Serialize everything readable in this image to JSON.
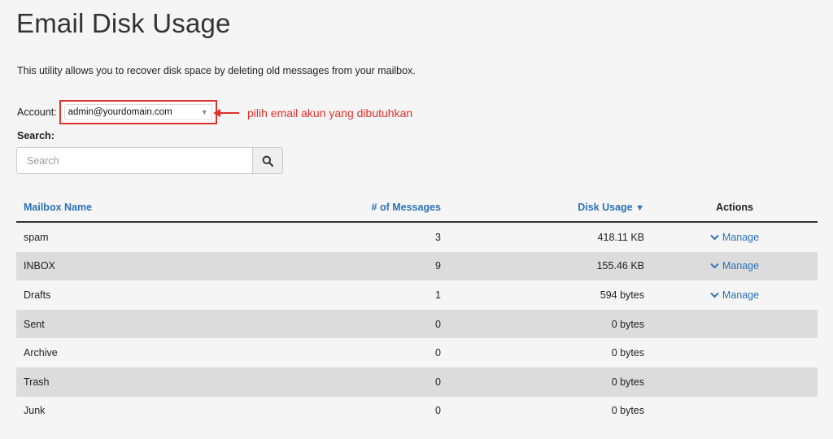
{
  "page": {
    "title": "Email Disk Usage",
    "intro": "This utility allows you to recover disk space by deleting old messages from your mailbox."
  },
  "account": {
    "label": "Account:",
    "selected": "admin@yourdomain.com"
  },
  "annotation": {
    "text": "pilih email akun yang dibutuhkan",
    "color": "#e0302a"
  },
  "search": {
    "label": "Search:",
    "placeholder": "Search",
    "button_icon": "search-icon"
  },
  "table": {
    "headers": {
      "name": "Mailbox Name",
      "messages": "# of Messages",
      "usage": "Disk Usage",
      "usage_sort": "▼",
      "actions": "Actions"
    },
    "rows": [
      {
        "name": "spam",
        "messages": "3",
        "usage": "418.11 KB",
        "action": "Manage"
      },
      {
        "name": "INBOX",
        "messages": "9",
        "usage": "155.46 KB",
        "action": "Manage"
      },
      {
        "name": "Drafts",
        "messages": "1",
        "usage": "594 bytes",
        "action": "Manage"
      },
      {
        "name": "Sent",
        "messages": "0",
        "usage": "0 bytes",
        "action": ""
      },
      {
        "name": "Archive",
        "messages": "0",
        "usage": "0 bytes",
        "action": ""
      },
      {
        "name": "Trash",
        "messages": "0",
        "usage": "0 bytes",
        "action": ""
      },
      {
        "name": "Junk",
        "messages": "0",
        "usage": "0 bytes",
        "action": ""
      }
    ]
  },
  "colors": {
    "link": "#2d72b8",
    "stripe": "#dcdcdc",
    "background": "#f5f5f5"
  }
}
